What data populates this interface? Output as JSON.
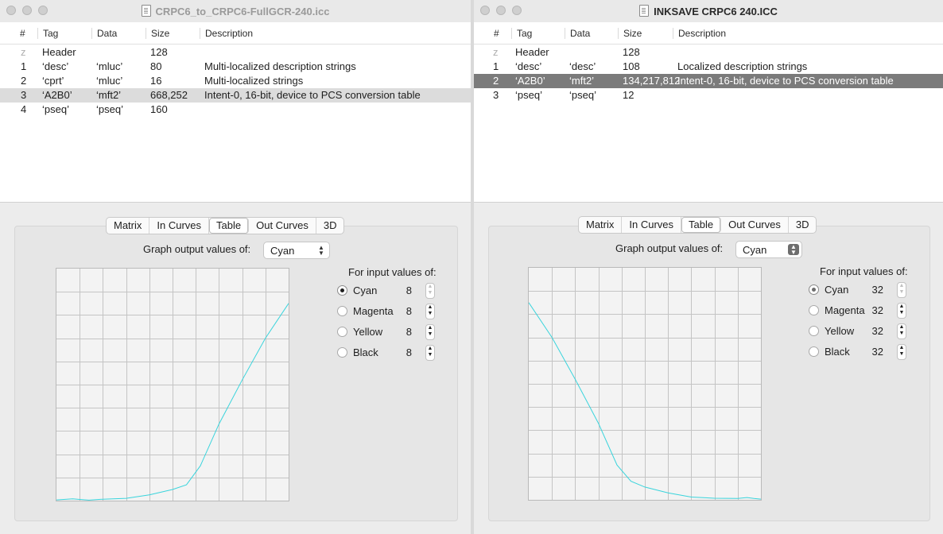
{
  "left": {
    "title": "CRPC6_to_CRPC6-FullGCR-240.icc",
    "columns": {
      "num": "#",
      "tag": "Tag",
      "data": "Data",
      "size": "Size",
      "desc": "Description"
    },
    "rows": [
      {
        "num": "z",
        "tag": "Header",
        "data": "",
        "size": "128",
        "desc": ""
      },
      {
        "num": "1",
        "tag": "‘desc’",
        "data": "‘mluc’",
        "size": "80",
        "desc": "Multi-localized description strings"
      },
      {
        "num": "2",
        "tag": "‘cprt’",
        "data": "‘mluc’",
        "size": "16",
        "desc": "Multi-localized strings"
      },
      {
        "num": "3",
        "tag": "‘A2B0’",
        "data": "‘mft2’",
        "size": "668,252",
        "desc": "Intent-0, 16-bit, device to PCS conversion table"
      },
      {
        "num": "4",
        "tag": "‘pseq’",
        "data": "‘pseq’",
        "size": "160",
        "desc": ""
      }
    ],
    "tabs": [
      "Matrix",
      "In Curves",
      "Table",
      "Out Curves",
      "3D"
    ],
    "active_tab": "Table",
    "graph_output_label": "Graph output values of:",
    "graph_output_value": "Cyan",
    "input_label": "For input values of:",
    "inputs": [
      {
        "label": "Cyan",
        "value": "8",
        "selected": true
      },
      {
        "label": "Magenta",
        "value": "8",
        "selected": false
      },
      {
        "label": "Yellow",
        "value": "8",
        "selected": false
      },
      {
        "label": "Black",
        "value": "8",
        "selected": false
      }
    ],
    "curve_color": "#39d4dc"
  },
  "right": {
    "title": "INKSAVE CRPC6 240.ICC",
    "columns": {
      "num": "#",
      "tag": "Tag",
      "data": "Data",
      "size": "Size",
      "desc": "Description"
    },
    "rows": [
      {
        "num": "z",
        "tag": "Header",
        "data": "",
        "size": "128",
        "desc": ""
      },
      {
        "num": "1",
        "tag": "‘desc’",
        "data": "‘desc’",
        "size": "108",
        "desc": "Localized description strings"
      },
      {
        "num": "2",
        "tag": "‘A2B0’",
        "data": "‘mft2’",
        "size": "134,217,812",
        "desc": "Intent-0, 16-bit, device to PCS conversion table"
      },
      {
        "num": "3",
        "tag": "‘pseq’",
        "data": "‘pseq’",
        "size": "12",
        "desc": ""
      }
    ],
    "tabs": [
      "Matrix",
      "In Curves",
      "Table",
      "Out Curves",
      "3D"
    ],
    "active_tab": "Table",
    "graph_output_label": "Graph output values of:",
    "graph_output_value": "Cyan",
    "input_label": "For input values of:",
    "inputs": [
      {
        "label": "Cyan",
        "value": "32",
        "selected": true
      },
      {
        "label": "Magenta",
        "value": "32",
        "selected": false
      },
      {
        "label": "Yellow",
        "value": "32",
        "selected": false
      },
      {
        "label": "Black",
        "value": "32",
        "selected": false
      }
    ],
    "curve_color": "#39d4dc"
  }
}
